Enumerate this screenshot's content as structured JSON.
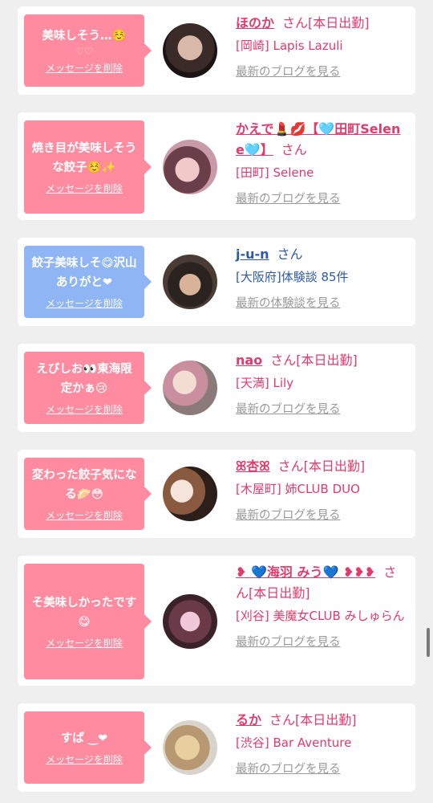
{
  "colors": {
    "accent_pink": "#e33a6c",
    "bubble_pink": "#fe8ba0",
    "bubble_blue": "#8fb5f5",
    "link_blue": "#2d5aa6"
  },
  "messages": [
    {
      "text": "美味しそう…☺️",
      "extra": "♡♡",
      "delete_label": "メッセージを削除",
      "name": "ほのか",
      "honorific": "さん",
      "status": "[本日出勤]",
      "shop": "[岡崎] Lapis Lazuli",
      "link": "最新のブログを見る"
    },
    {
      "text": "焼き目が美味しそうな餃子☺️✨",
      "delete_label": "メッセージを削除",
      "name": "かえで💄💋【🩵田町Selene🩵】",
      "honorific": "さん",
      "status": "",
      "shop": "[田町] Selene",
      "link": "最新のブログを見る"
    },
    {
      "text": "餃子美味しそ😋沢山ありがと❤",
      "delete_label": "メッセージを削除",
      "name": "j-u-n",
      "honorific": "さん",
      "status": "",
      "shop": "[大阪府]体験談 85件",
      "link": "最新の体験談を見る"
    },
    {
      "text": "えびしお👀東海限定かぁ😢",
      "delete_label": "メッセージを削除",
      "name": "nao",
      "honorific": "さん",
      "status": "[本日出勤]",
      "shop": "[天満] Lily",
      "link": "最新のブログを見る"
    },
    {
      "text": "変わった餃子気になる🥟😳",
      "delete_label": "メッセージを削除",
      "name": "ꕤ杏ꕤ",
      "honorific": "さん",
      "status": "[本日出勤]",
      "shop": "[木屋町] 姉CLUB DUO",
      "link": "最新のブログを見る"
    },
    {
      "text": "そ美味しかったです😋",
      "delete_label": "メッセージを削除",
      "name": "❥ 💙海羽 みう💙 ❥❥❥",
      "honorific": "さん",
      "status": "[本日出勤]",
      "shop": "[刈谷] 美魔女CLUB みしゅらん",
      "link": "最新のブログを見る"
    },
    {
      "text": "すぱ ‿❤",
      "delete_label": "メッセージを削除",
      "name": "るか",
      "honorific": "さん",
      "status": "[本日出勤]",
      "shop": "[渋谷] Bar Aventure",
      "link": "最新のブログを見る"
    }
  ]
}
